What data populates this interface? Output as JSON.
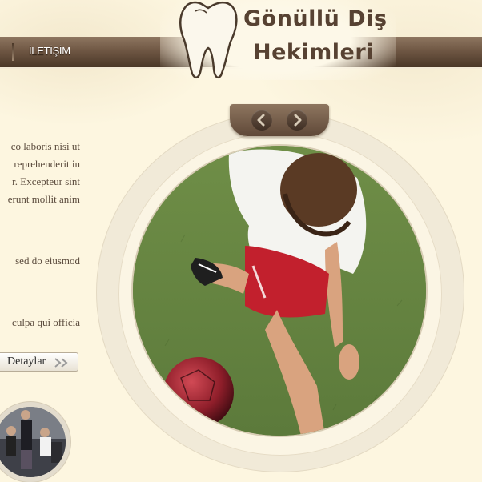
{
  "nav": {
    "item_contact": "İLETİŞİM"
  },
  "brand": {
    "line1": "Gönüllü Diş",
    "line2": "Hekimleri"
  },
  "content": {
    "paragraphs": [
      [
        "co laboris nisi ut",
        "reprehenderit in",
        "r. Excepteur sint",
        "erunt mollit anim"
      ],
      [
        "sed do eiusmod"
      ],
      [
        "culpa qui officia"
      ]
    ],
    "details_label": "Detaylar"
  },
  "slider": {
    "prev_icon": "chevron-left-icon",
    "next_icon": "chevron-right-icon"
  },
  "colors": {
    "background": "#fdf6e0",
    "nav": "#6f5744",
    "brand_text": "#574232",
    "body_text": "#5a4a3c"
  }
}
